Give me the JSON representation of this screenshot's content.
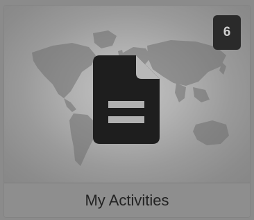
{
  "tile": {
    "title": "My Activities",
    "badge_count": "6",
    "icon": "document-icon",
    "background": "world-map"
  },
  "colors": {
    "overlay": "#8b8b8b",
    "badge_bg": "#2a2a2a",
    "icon": "#1e1e1e",
    "title_text": "#222222"
  }
}
